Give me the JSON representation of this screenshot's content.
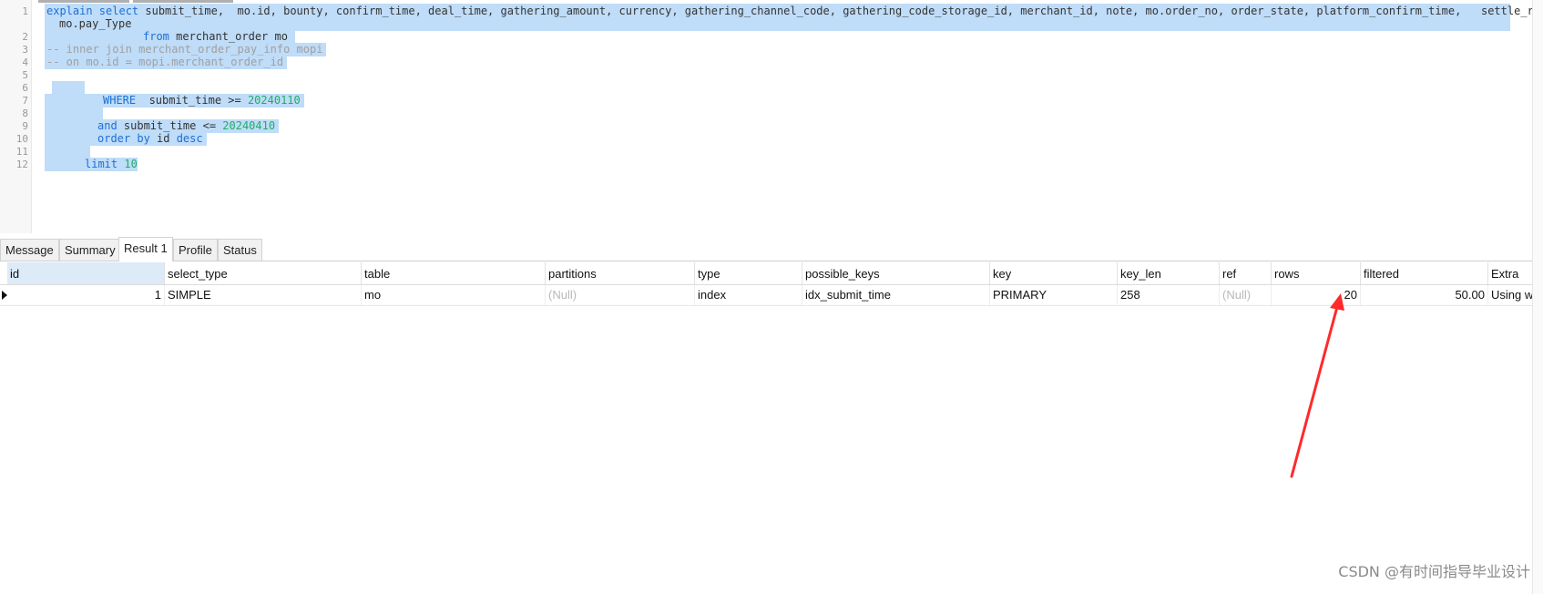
{
  "editor": {
    "line_numbers": [
      "1",
      "2",
      "3",
      "4",
      "5",
      "6",
      "7",
      "8",
      "9",
      "10",
      "11",
      "12"
    ],
    "line1_kw": "explain select",
    "line1_text": " submit_time,  mo.id, bounty, confirm_time, deal_time, gathering_amount, currency, gathering_channel_code, gathering_code_storage_id, merchant_id, note, mo.order_no, order_state, platform_confirm_time,   settle_rate,",
    "line1_wrap": "mo.pay_Type",
    "line2_kw": "from",
    "line2_text": " merchant_order mo",
    "line3": "-- inner join merchant_order_pay_info mopi",
    "line4": "-- on mo.id = mopi.merchant_order_id",
    "line7_kw": "WHERE",
    "line7_text": "  submit_time >= ",
    "line7_num": "20240110",
    "line9_kw": "and",
    "line9_text": " submit_time <= ",
    "line9_num": "20240410",
    "line10_kw": "order by",
    "line10_text": " id ",
    "line10_kw2": "desc",
    "line12_kw": "limit",
    "line12_num": "10"
  },
  "tabs": [
    "Message",
    "Summary",
    "Result 1",
    "Profile",
    "Status"
  ],
  "active_tab": "Result 1",
  "grid": {
    "columns": [
      "id",
      "select_type",
      "table",
      "partitions",
      "type",
      "possible_keys",
      "key",
      "key_len",
      "ref",
      "rows",
      "filtered",
      "Extra"
    ],
    "rows": [
      {
        "id": "1",
        "select_type": "SIMPLE",
        "table": "mo",
        "partitions": "(Null)",
        "type": "index",
        "possible_keys": "idx_submit_time",
        "key": "PRIMARY",
        "key_len": "258",
        "ref": "(Null)",
        "rows": "20",
        "filtered": "50.00",
        "Extra": "Using w"
      }
    ]
  },
  "annotation_color": "#ff2a2a",
  "watermark": "CSDN @有时间指导毕业设计"
}
